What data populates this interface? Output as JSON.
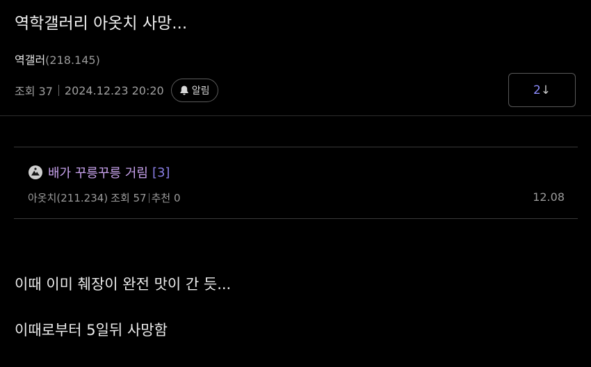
{
  "post": {
    "title": "역학갤러리 아옷치 사망...",
    "author_name": "역갤러",
    "author_ip": "(218.145)",
    "views": "조회 37",
    "datetime": "2024.12.23 20:20",
    "alarm_label": "알림",
    "comment_count": "2",
    "comment_arrow": "↓"
  },
  "related": {
    "title": "배가 꾸릉꾸릉 거림",
    "comment_count": "[3]",
    "author": "아옷치(211.234)",
    "views": "조회 57",
    "recommend": "추천 0",
    "date": "12.08"
  },
  "body": {
    "line1": "이때 이미 췌장이 완전 맛이 간 듯...",
    "line2": "이때로부터 5일뒤 사망함"
  },
  "colors": {
    "background": "#000000",
    "related_title": "#c9a3ee",
    "comment_accent": "#8b80e8"
  },
  "icons": {
    "alarm": "bell-icon",
    "related": "mountain-badge-icon"
  }
}
